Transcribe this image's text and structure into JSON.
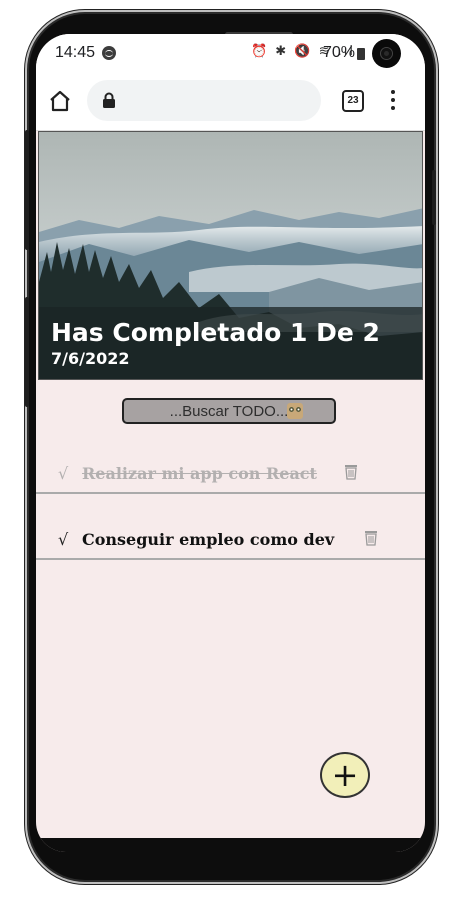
{
  "status_bar": {
    "time": "14:45",
    "icons": "⏰ ✱ 🔇 ≋ .ıl",
    "battery": "70%"
  },
  "browser": {
    "tab_count": "23"
  },
  "header": {
    "title": "Has Completado 1 De 2",
    "date": "7/6/2022"
  },
  "search": {
    "placeholder": "...Buscar TODO..."
  },
  "todos": [
    {
      "check": "√",
      "text": "Realizar mi app con React",
      "completed": true
    },
    {
      "check": "√",
      "text": "Conseguir empleo como dev",
      "completed": false
    }
  ],
  "fab": {
    "label": "+"
  },
  "colors": {
    "background": "#f7ebeb",
    "search_bg": "#a7a2a2",
    "fab_bg": "#f2efb9",
    "completed_text": "#b3b0b0"
  }
}
